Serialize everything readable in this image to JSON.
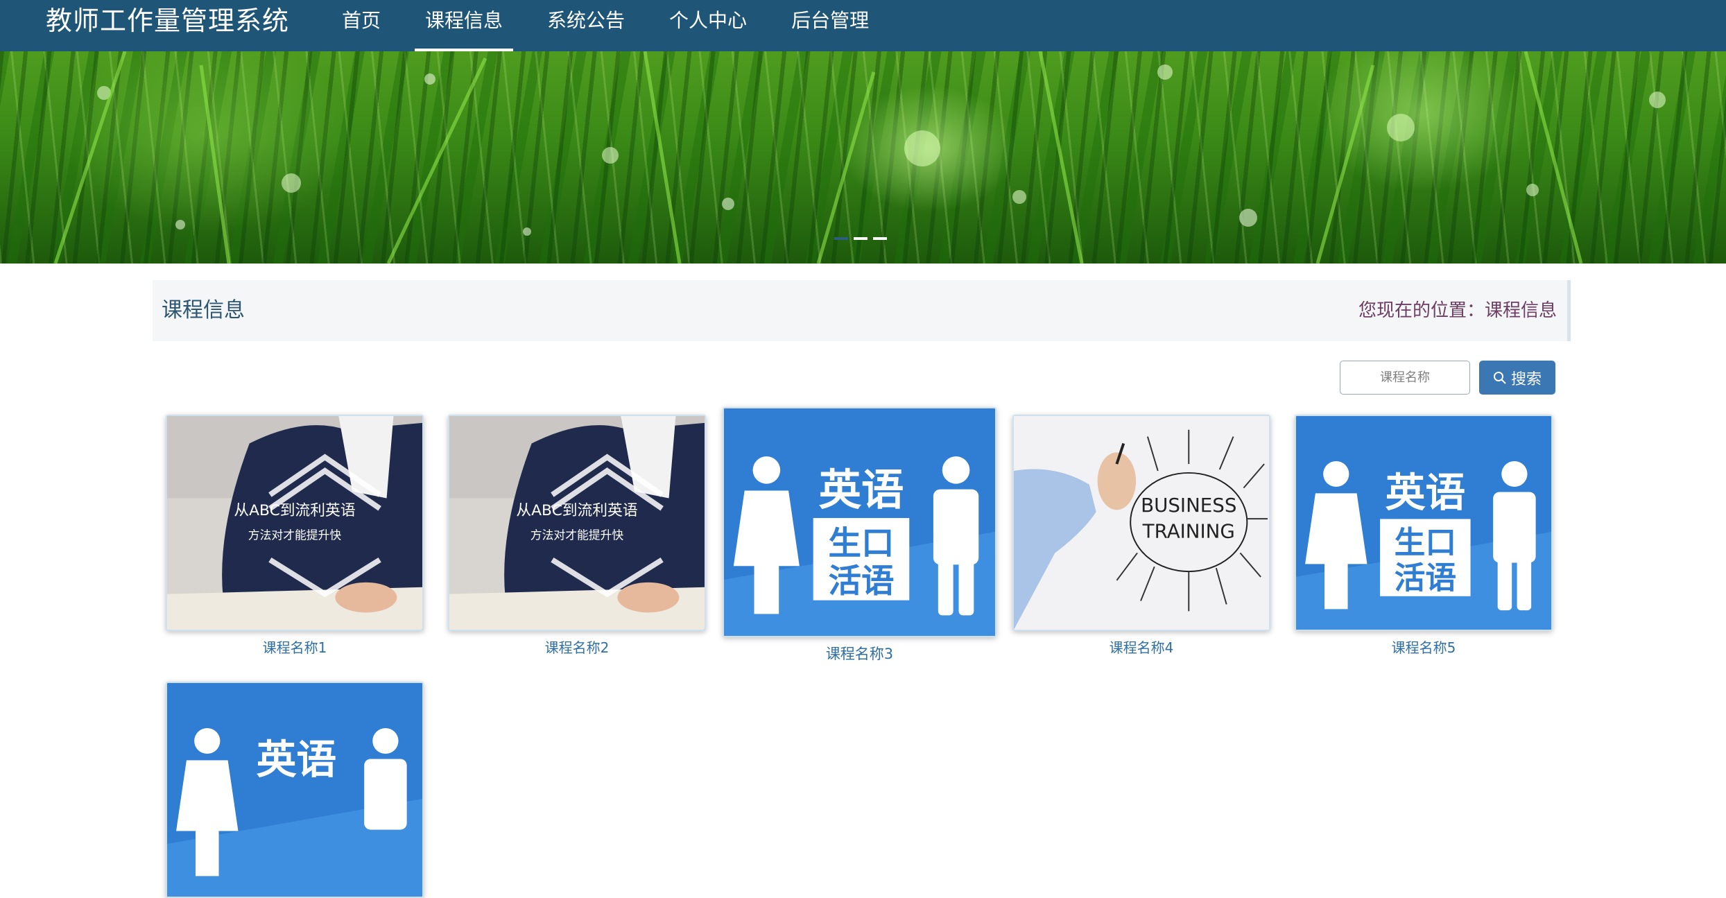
{
  "header": {
    "brand": "教师工作量管理系统",
    "nav": [
      {
        "label": "首页"
      },
      {
        "label": "课程信息"
      },
      {
        "label": "系统公告"
      },
      {
        "label": "个人中心"
      },
      {
        "label": "后台管理"
      }
    ],
    "active_nav": "课程信息"
  },
  "banner": {
    "slide_count": 3,
    "active_slide": 1
  },
  "titlebar": {
    "title": "课程信息",
    "location_prefix": "您现在的位置：",
    "location_current": "课程信息"
  },
  "search": {
    "placeholder": "课程名称",
    "button_label": "搜索"
  },
  "courses": [
    {
      "name": "课程名称1",
      "image": "classroom-student-image",
      "line1": "从ABC到流利英语",
      "line2": "方法对才能提升快"
    },
    {
      "name": "课程名称2",
      "image": "classroom-student-image",
      "line1": "从ABC到流利英语",
      "line2": "方法对才能提升快"
    },
    {
      "name": "课程名称3",
      "image": "english-oral-image",
      "line1": "英语",
      "line2": "生口",
      "line3": "活语"
    },
    {
      "name": "课程名称4",
      "image": "business-training-image",
      "line1": "BUSINESS",
      "line2": "TRAINING"
    },
    {
      "name": "课程名称5",
      "image": "english-oral-image",
      "line1": "英语",
      "line2": "生口",
      "line3": "活语"
    },
    {
      "name": "",
      "image": "english-oral-image",
      "line1": "英语"
    }
  ],
  "colors": {
    "header_bg": "#1f5678",
    "accent": "#3a77b3",
    "card_link": "#2f6fa3",
    "location_text": "#6d3d63"
  }
}
